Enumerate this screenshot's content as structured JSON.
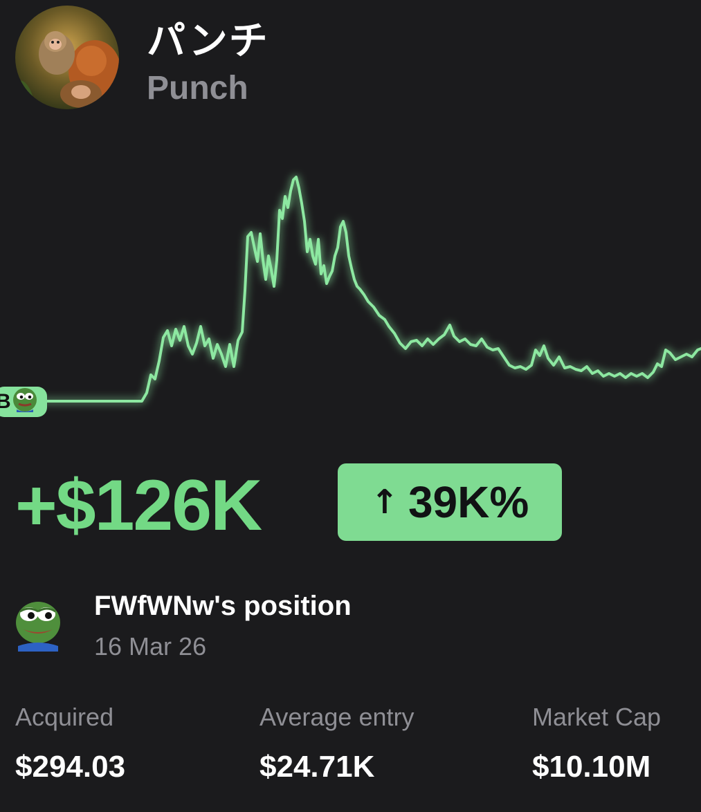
{
  "token": {
    "name": "パンチ",
    "symbol": "Punch",
    "avatar_icon": "monkey-avatar-icon"
  },
  "chart": {
    "line_color": "#8de8a1",
    "buy_marker_label": "B",
    "buy_marker_icon": "pepe-frog-icon"
  },
  "pnl": {
    "amount": "+$126K",
    "percent": "39K%",
    "arrow": "↑",
    "color": "#73d985",
    "badge_color": "#7fdb92"
  },
  "position": {
    "title": "FWfWNw's position",
    "date": "16 Mar 26",
    "icon": "pepe-frog-icon"
  },
  "stats": [
    {
      "label": "Acquired",
      "value": "$294.03"
    },
    {
      "label": "Average entry",
      "value": "$24.71K"
    },
    {
      "label": "Market Cap",
      "value": "$10.10M"
    }
  ]
}
